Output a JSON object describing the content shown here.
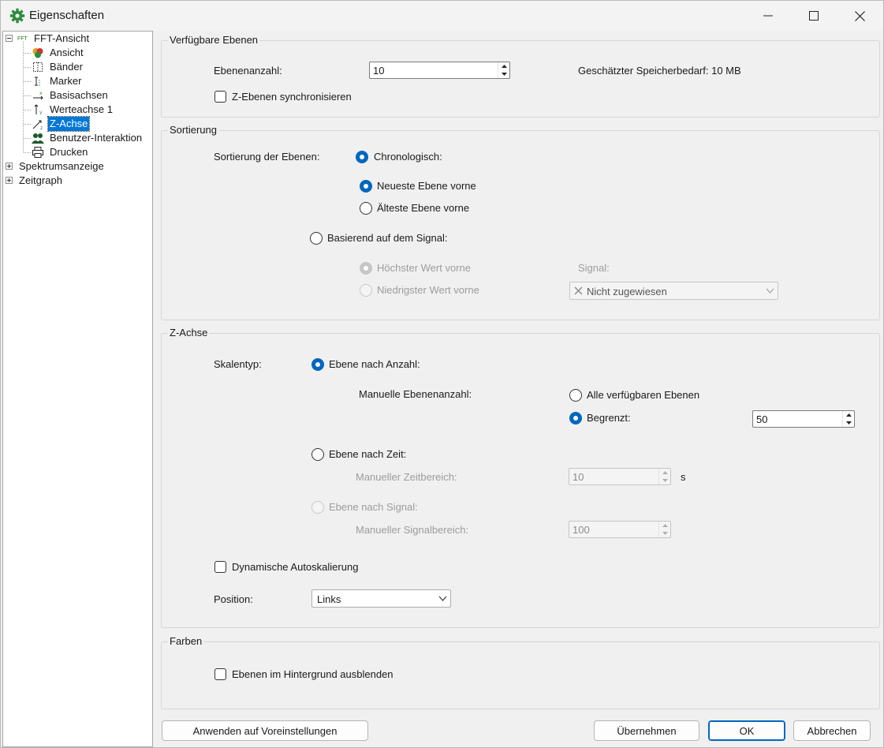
{
  "window": {
    "title": "Eigenschaften"
  },
  "tree": {
    "root": "FFT-Ansicht",
    "root_prefix": "FFT",
    "children": [
      "Ansicht",
      "Bänder",
      "Marker",
      "Basisachsen",
      "Werteachse 1",
      "Z-Achse",
      "Benutzer-Interaktion",
      "Drucken"
    ],
    "selected": "Z-Achse",
    "other_roots": [
      "Spektrumsanzeige",
      "Zeitgraph"
    ]
  },
  "layers": {
    "title": "Verfügbare Ebenen",
    "count_label": "Ebenenanzahl:",
    "count_value": "10",
    "memory_label": "Geschätzter Speicherbedarf: 10 MB",
    "sync_label": "Z-Ebenen synchronisieren"
  },
  "sorting": {
    "title": "Sortierung",
    "label": "Sortierung der Ebenen:",
    "chronological": "Chronologisch:",
    "newest_front": "Neueste Ebene vorne",
    "oldest_front": "Älteste Ebene vorne",
    "signal_based": "Basierend auf dem Signal:",
    "highest_front": "Höchster Wert vorne",
    "lowest_front": "Niedrigster Wert vorne",
    "signal_label": "Signal:",
    "signal_value": "Nicht zugewiesen"
  },
  "zaxis": {
    "title": "Z-Achse",
    "scale_label": "Skalentyp:",
    "by_count": "Ebene nach Anzahl:",
    "manual_count": "Manuelle Ebenenanzahl:",
    "all_layers": "Alle verfügbaren Ebenen",
    "limited": "Begrenzt:",
    "limited_value": "50",
    "by_time": "Ebene nach Zeit:",
    "manual_time": "Manueller Zeitbereich:",
    "time_value": "10",
    "time_unit": "s",
    "by_signal": "Ebene nach Signal:",
    "manual_signal": "Manueller Signalbereich:",
    "signal_value": "100",
    "autoscale": "Dynamische Autoskalierung",
    "position_label": "Position:",
    "position_value": "Links"
  },
  "colors": {
    "title": "Farben",
    "hide_bg": "Ebenen im Hintergrund ausblenden"
  },
  "buttons": {
    "apply_defaults": "Anwenden auf Voreinstellungen",
    "apply": "Übernehmen",
    "ok": "OK",
    "cancel": "Abbrechen"
  },
  "theme": {
    "accent": "#0067c0",
    "selection": "#0078d7"
  }
}
